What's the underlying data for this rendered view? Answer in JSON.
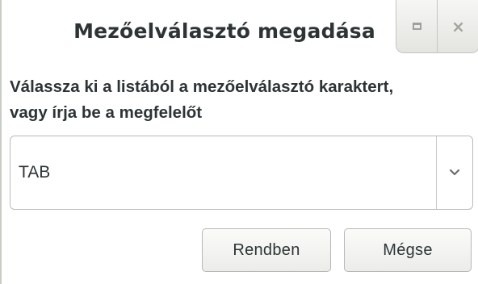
{
  "window": {
    "title": "Mezőelválasztó megadása"
  },
  "titlebar_buttons": {
    "maximize_icon": "maximize-icon",
    "close_icon": "close-icon",
    "close_glyph": "×"
  },
  "prompt": {
    "line1": "Válassza ki a listából a mezőelválasztó karaktert,",
    "line2": "vagy írja be a megfelelőt"
  },
  "combo": {
    "value": "TAB",
    "arrow_icon": "chevron-down-icon"
  },
  "buttons": {
    "ok_label": "Rendben",
    "cancel_label": "Mégse"
  },
  "colors": {
    "text": "#2e3436",
    "border": "#b9bcb6",
    "wm_icon": "#9da19b"
  }
}
